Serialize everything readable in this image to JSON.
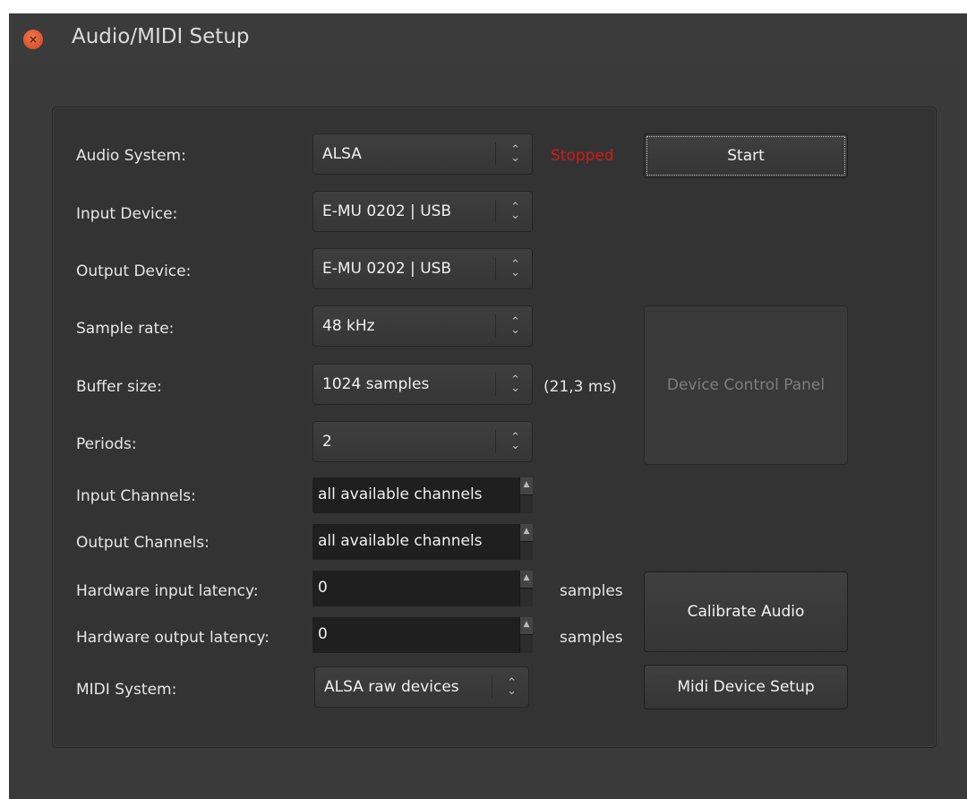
{
  "window": {
    "title": "Audio/MIDI Setup"
  },
  "labels": {
    "audio_system": "Audio System:",
    "input_device": "Input Device:",
    "output_device": "Output Device:",
    "sample_rate": "Sample rate:",
    "buffer_size": "Buffer size:",
    "periods": "Periods:",
    "input_channels": "Input Channels:",
    "output_channels": "Output Channels:",
    "hw_input_latency": "Hardware input latency:",
    "hw_output_latency": "Hardware output latency:",
    "midi_system": "MIDI System:"
  },
  "values": {
    "audio_system": "ALSA",
    "input_device": "E-MU 0202 | USB",
    "output_device": "E-MU 0202 | USB",
    "sample_rate": "48 kHz",
    "buffer_size": "1024 samples",
    "periods": "2",
    "input_channels": "all available channels",
    "output_channels": "all available channels",
    "hw_input_latency": "0",
    "hw_output_latency": "0",
    "midi_system": "ALSA raw devices"
  },
  "status": {
    "text": "Stopped",
    "color": "#d21a1a"
  },
  "buffer_latency": "(21,3 ms)",
  "units": {
    "input_latency": "samples",
    "output_latency": "samples"
  },
  "buttons": {
    "start": "Start",
    "device_control_panel": "Device Control Panel",
    "calibrate_audio": "Calibrate Audio",
    "midi_device_setup": "Midi Device Setup"
  },
  "icons": {
    "close": "close-icon",
    "combo_arrows": "up-down-arrows-icon",
    "spin": "spin-up-icon"
  }
}
